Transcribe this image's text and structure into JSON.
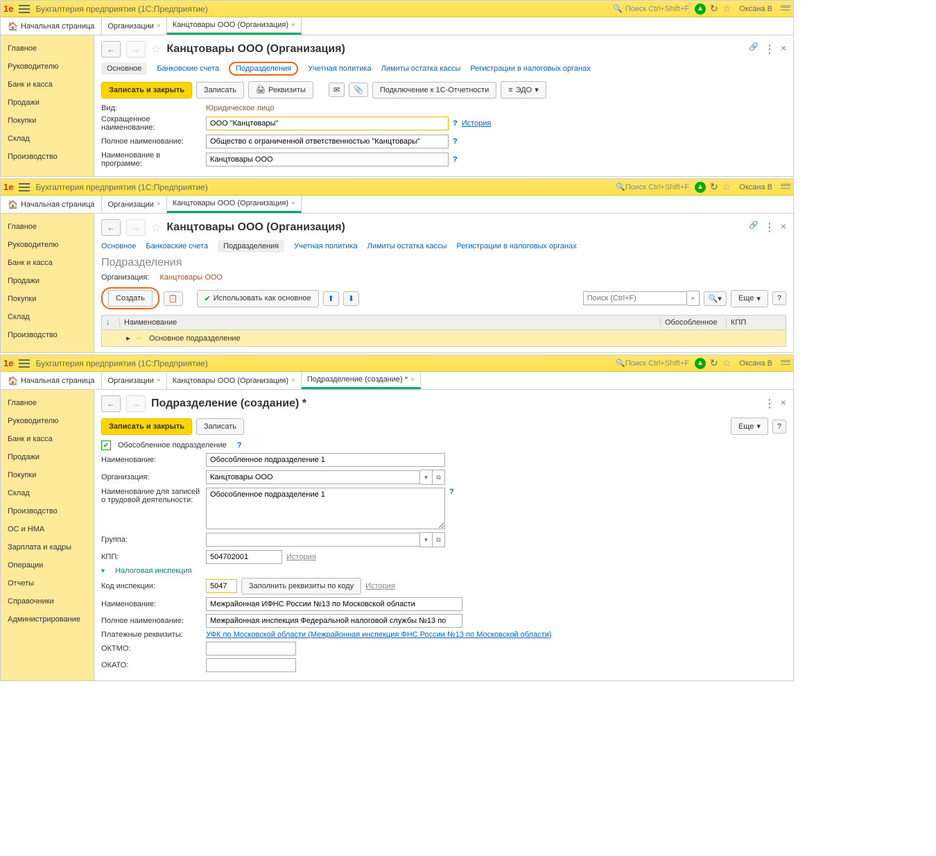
{
  "app": {
    "title": "Бухгалтерия предприятия  (1С:Предприятие)",
    "search_placeholder": "Поиск Ctrl+Shift+F",
    "user": "Оксана В"
  },
  "nav": {
    "home": "Начальная страница",
    "tabs": [
      {
        "label": "Организации"
      },
      {
        "label": "Канцтовары ООО (Организация)"
      },
      {
        "label": "Подразделение (создание) *"
      }
    ]
  },
  "sidebar": [
    "Главное",
    "Руководителю",
    "Банк и касса",
    "Продажи",
    "Покупки",
    "Склад",
    "Производство",
    "ОС и НМА",
    "Зарплата и кадры",
    "Операции",
    "Отчеты",
    "Справочники",
    "Администрирование"
  ],
  "window1": {
    "title": "Канцтовары ООО (Организация)",
    "subtabs": [
      "Основное",
      "Банковские счета",
      "Подразделения",
      "Учетная политика",
      "Лимиты остатка кассы",
      "Регистрации в налоговых органах"
    ],
    "btn_save_close": "Записать и закрыть",
    "btn_save": "Записать",
    "btn_requisites": "Реквизиты",
    "btn_connect": "Подключение к 1С-Отчетности",
    "btn_edo": "ЭДО",
    "vid_label": "Вид:",
    "vid_val": "Юридическое лицо",
    "short_label": "Сокращенное наименование:",
    "short_val": "ООО \"Канцтовары\"",
    "history": "История",
    "full_label": "Полное наименование:",
    "full_val": "Общество с ограниченной ответственностью \"Канцтовары\"",
    "prog_label": "Наименование в программе:",
    "prog_val": "Канцтовары ООО"
  },
  "window2": {
    "section": "Подразделения",
    "org_label": "Организация:",
    "org_val": "Канцтовары ООО",
    "btn_create": "Создать",
    "btn_default": "Использовать как основное",
    "search_ph": "Поиск (Ctrl+F)",
    "btn_more": "Еще",
    "col_name": "Наименование",
    "col_sep": "Обособленное",
    "col_kpp": "КПП",
    "row1": "Основное подразделение"
  },
  "window3": {
    "title": "Подразделение (создание) *",
    "btn_save_close": "Записать и закрыть",
    "btn_save": "Записать",
    "btn_more": "Еще",
    "chk_label": "Обособленное подразделение",
    "name_label": "Наименование:",
    "name_val": "Обособленное подразделение 1",
    "org_label": "Организация:",
    "org_val": "Канцтовары ООО",
    "labor_label": "Наименование для записей о трудовой деятельности:",
    "labor_val": "Обособленное подразделение 1",
    "group_label": "Группа:",
    "group_val": "",
    "kpp_label": "КПП:",
    "kpp_val": "504702001",
    "history": "История",
    "tax_section": "Налоговая инспекция",
    "code_label": "Код инспекции:",
    "code_val": "5047",
    "btn_fill": "Заполнить реквизиты по коду",
    "ins_name_label": "Наименование:",
    "ins_name_val": "Межрайонная ИФНС России №13 по Московской области",
    "ins_full_label": "Полное наименование:",
    "ins_full_val": "Межрайонная инспекция Федеральной налоговой службы №13 по",
    "pay_label": "Платежные реквизиты:",
    "pay_link": "УФК по Московской области (Межрайонная инспекция ФНС России №13 по Московской области)",
    "oktmo_label": "ОКТМО:",
    "oktmo_val": "",
    "okato_label": "ОКАТО:",
    "okato_val": ""
  }
}
